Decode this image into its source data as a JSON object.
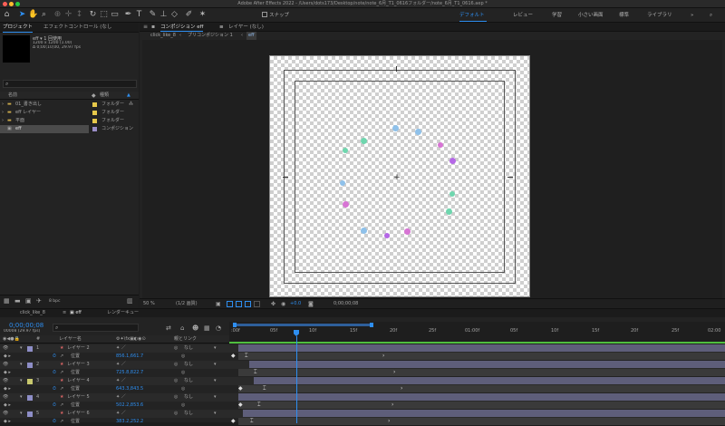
{
  "window": {
    "title": "Adobe After Effects 2022 - /Users/dots173/Desktop/note/note_6月_T1_0616フォルダー/note_6月_T1_0616.aep *"
  },
  "toolbar": {
    "snap_label": "スナップ",
    "workspaces": [
      "デフォルト",
      "レビュー",
      "学習",
      "小さい画面",
      "標準",
      "ライブラリ"
    ]
  },
  "project": {
    "tabs": [
      "プロジェクト",
      "エフェクトコントロール (なし"
    ],
    "selected_name": "eff ▾ 1 回使用",
    "info": [
      "1200 x 1200 (1.00)",
      "Δ 0;00;10;00, 29.97 fps"
    ],
    "columns": {
      "name": "名前",
      "type": "種類"
    },
    "items": [
      {
        "name": "01_書き出し",
        "type": "フォルダー"
      },
      {
        "name": "eff レイヤー",
        "type": "フォルダー"
      },
      {
        "name": "平面",
        "type": "フォルダー"
      },
      {
        "name": "eff",
        "type": "コンポジション"
      }
    ],
    "bit_depth": "8 bpc"
  },
  "comp": {
    "tab_label": "コンポジション",
    "tab_comp": "eff",
    "layer_tab": "レイヤー (なし)",
    "breadcrumbs": [
      "click_like_8",
      "プリコンポジション 1",
      "eff"
    ],
    "zoom": "50 %",
    "resolution": "(1/2 画質)",
    "exposure": "+0.0",
    "timecode": "0;00;00;08"
  },
  "timeline": {
    "tabs": [
      "click_like_8",
      "eff",
      "レンダーキュー"
    ],
    "current_time": "0;00;00;08",
    "frame_info": "00008 (29.97 fps)",
    "columns": {
      "layer": "レイヤー名",
      "parent": "親とリンク"
    },
    "ruler": [
      ":00f",
      "05f",
      "10f",
      "15f",
      "20f",
      "25f",
      "01:00f",
      "05f",
      "10f",
      "15f",
      "20f",
      "25f",
      "02:00"
    ],
    "layers": [
      {
        "num": "1",
        "name": "レイヤー 2",
        "pos": "856.1,661.7",
        "parent": "なし",
        "color": "#8e8ec7"
      },
      {
        "num": "2",
        "name": "レイヤー 3",
        "pos": "725.8,822.7",
        "parent": "なし",
        "color": "#8e8ec7"
      },
      {
        "num": "3",
        "name": "レイヤー 4",
        "pos": "643.3,843.5",
        "parent": "なし",
        "color": "#c9c96e"
      },
      {
        "num": "4",
        "name": "レイヤー 5",
        "pos": "502.2,853.6",
        "parent": "なし",
        "color": "#8e8ec7"
      },
      {
        "num": "5",
        "name": "レイヤー 6",
        "pos": "383.2,252.2",
        "parent": "なし",
        "color": "#8e8ec7"
      }
    ],
    "pos_label": "位置"
  },
  "colors": {
    "accent": "#2e8ef0",
    "kf_blue": "#8fc1ea",
    "kf_green": "#6fd6ae",
    "kf_pink": "#d774d4",
    "kf_purple": "#b467e6"
  }
}
